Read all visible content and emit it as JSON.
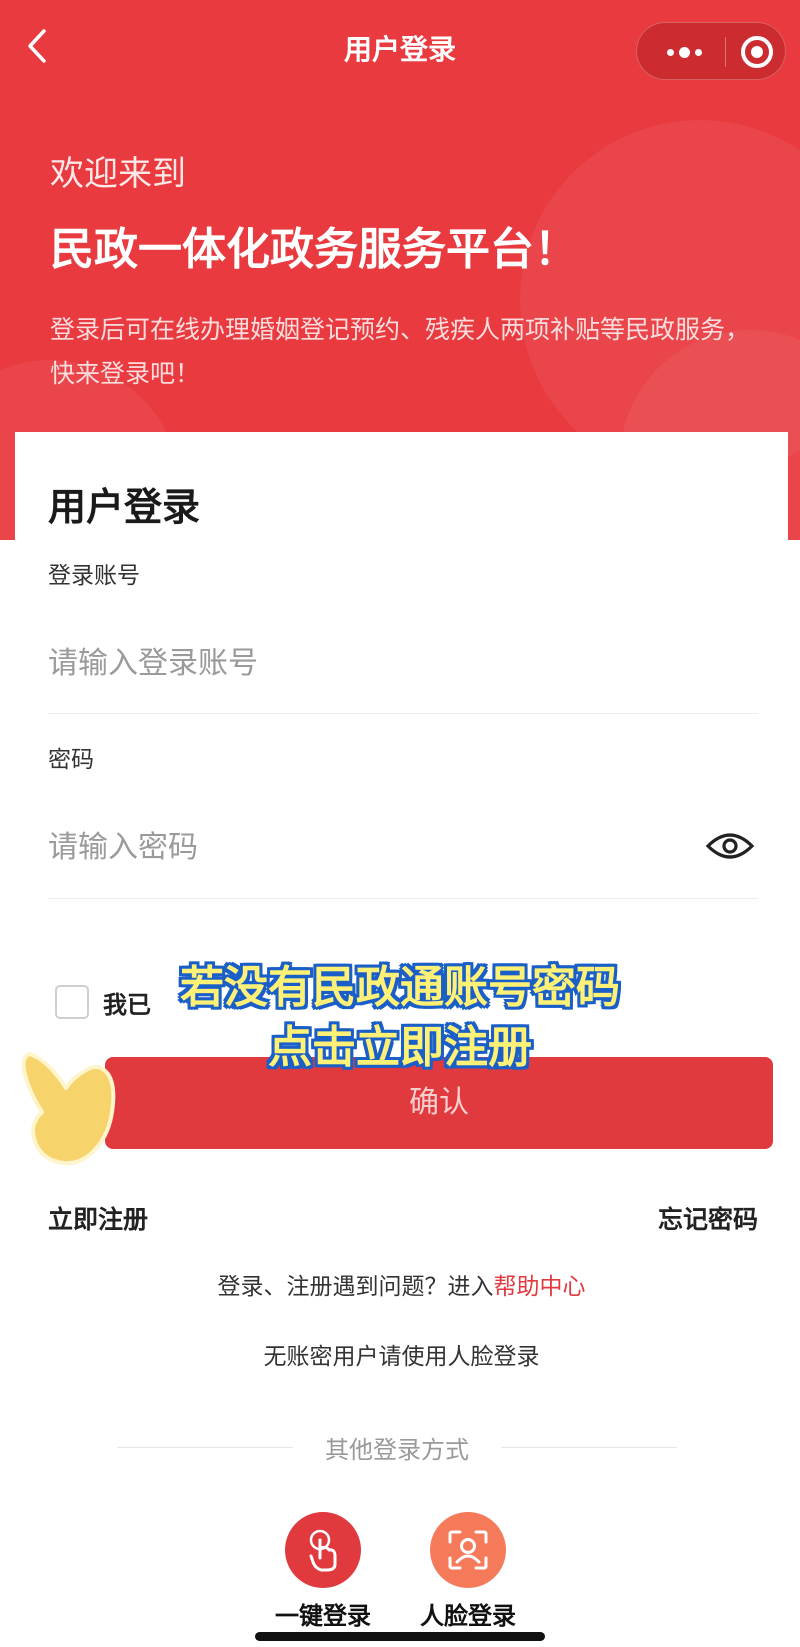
{
  "topbar": {
    "title": "用户登录",
    "back_icon": "chevron-left-icon",
    "menu_icon": "more-dots-icon",
    "close_icon": "target-circle-icon"
  },
  "hero": {
    "welcome": "欢迎来到",
    "platform_name": "民政一体化政务服务平台！",
    "description": "登录后可在线办理婚姻登记预约、残疾人两项补贴等民政服务，快来登录吧！"
  },
  "login_card": {
    "title": "用户登录",
    "account": {
      "label": "登录账号",
      "placeholder": "请输入登录账号",
      "value": ""
    },
    "password": {
      "label": "密码",
      "placeholder": "请输入密码",
      "value": "",
      "toggle_icon": "eye-icon"
    },
    "agreement_text": "我已",
    "confirm_label": "确认",
    "register_label": "立即注册",
    "forgot_label": "忘记密码",
    "help_prefix": "登录、注册遇到问题？进入",
    "help_link": "帮助中心",
    "face_note": "无账密用户请使用人脸登录",
    "other_methods_label": "其他登录方式",
    "options": [
      {
        "label": "一键登录",
        "icon": "tap-finger-icon",
        "color": "#e03a3f"
      },
      {
        "label": "人脸登录",
        "icon": "face-scan-icon",
        "color": "#f47a5a"
      }
    ]
  },
  "overlay": {
    "line1": "若没有民政通账号密码",
    "line2": "点击立即注册"
  },
  "colors": {
    "primary_red": "#e83a3f",
    "button_red": "#e03a3f",
    "caption_yellow": "#fff176",
    "caption_outline": "#1a5fc8"
  }
}
